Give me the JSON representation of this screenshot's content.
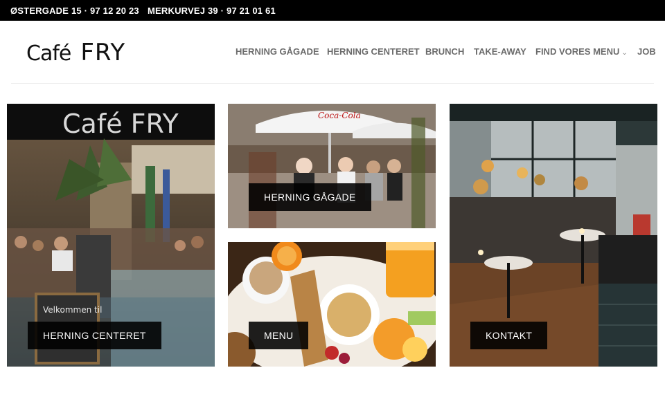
{
  "topbar": {
    "address_1": "ØSTERGADE 15 · 97 12 20 23",
    "address_2": "MERKURVEJ 39 · 97 21 01 61"
  },
  "logo": {
    "cafe": "Café",
    "fry": "FRY"
  },
  "nav": {
    "items": [
      {
        "label": "HERNING GÅGADE"
      },
      {
        "label": "HERNING CENTERET"
      },
      {
        "label": "BRUNCH"
      },
      {
        "label": "TAKE-AWAY"
      },
      {
        "label": "FIND VORES MENU",
        "has_dropdown": true
      },
      {
        "label": "JOB"
      }
    ],
    "dropdown_icon": "chevron-down-icon"
  },
  "tiles": {
    "centeret": {
      "label": "HERNING CENTERET"
    },
    "gaagade": {
      "label": "HERNING GÅGADE"
    },
    "menu": {
      "label": "MENU"
    },
    "kontakt": {
      "label": "KONTAKT"
    }
  },
  "photo_signs": {
    "cafe_fry_sign": "Café FRY",
    "chalkboard": "Velkommen til",
    "coca_cola": "Coca-Cola"
  },
  "colors": {
    "topbar_bg": "#000000",
    "nav_text": "#6b6b6b",
    "label_bg": "#000000"
  }
}
